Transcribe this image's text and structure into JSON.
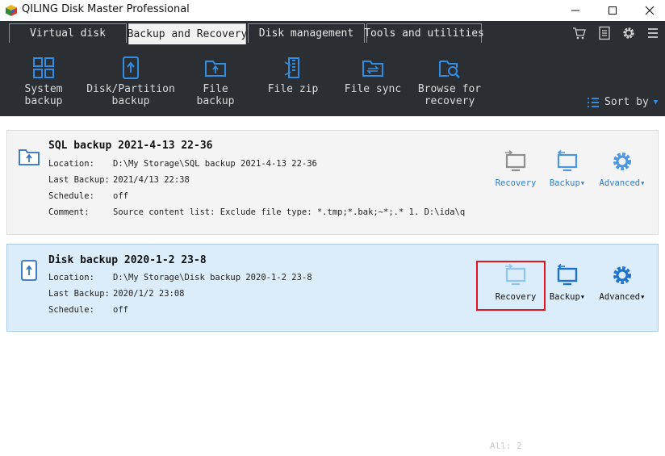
{
  "window": {
    "title": "QILING Disk Master Professional"
  },
  "tabs": [
    {
      "label": "Virtual disk"
    },
    {
      "label": "Backup and Recovery"
    },
    {
      "label": "Disk management"
    },
    {
      "label": "Tools and utilities"
    }
  ],
  "toolbar": {
    "items": [
      {
        "label": "System backup",
        "icon": "system-backup-icon"
      },
      {
        "label": "Disk/Partition\nbackup",
        "icon": "disk-partition-backup-icon"
      },
      {
        "label": "File backup",
        "icon": "file-backup-icon"
      },
      {
        "label": "File zip",
        "icon": "file-zip-icon"
      },
      {
        "label": "File sync",
        "icon": "file-sync-icon"
      },
      {
        "label": "Browse for\nrecovery",
        "icon": "browse-recovery-icon"
      }
    ],
    "sort_label": "Sort by"
  },
  "field_labels": {
    "location": "Location:",
    "last_backup": "Last Backup:",
    "schedule": "Schedule:",
    "comment": "Comment:"
  },
  "actions": {
    "recovery": "Recovery",
    "backup": "Backup▾",
    "advanced": "Advanced▾"
  },
  "backups": [
    {
      "title": "SQL backup 2021-4-13 22-36",
      "location": "D:\\My Storage\\SQL backup 2021-4-13 22-36",
      "last_backup": "2021/4/13 22:38",
      "schedule": "off",
      "comment": "Source content list:  Exclude file type: *.tmp;*.bak;~*;.*      1. D:\\ida\\q"
    },
    {
      "title": "Disk backup 2020-1-2 23-8",
      "location": "D:\\My Storage\\Disk backup 2020-1-2 23-8",
      "last_backup": "2020/1/2 23:08",
      "schedule": "off"
    }
  ],
  "footer": {
    "count": "All:  2"
  },
  "colors": {
    "dark_bar": "#2b2e33",
    "accent_blue": "#2f8de4",
    "selected_card": "#dbecfa",
    "highlight_red": "#e0141a"
  }
}
